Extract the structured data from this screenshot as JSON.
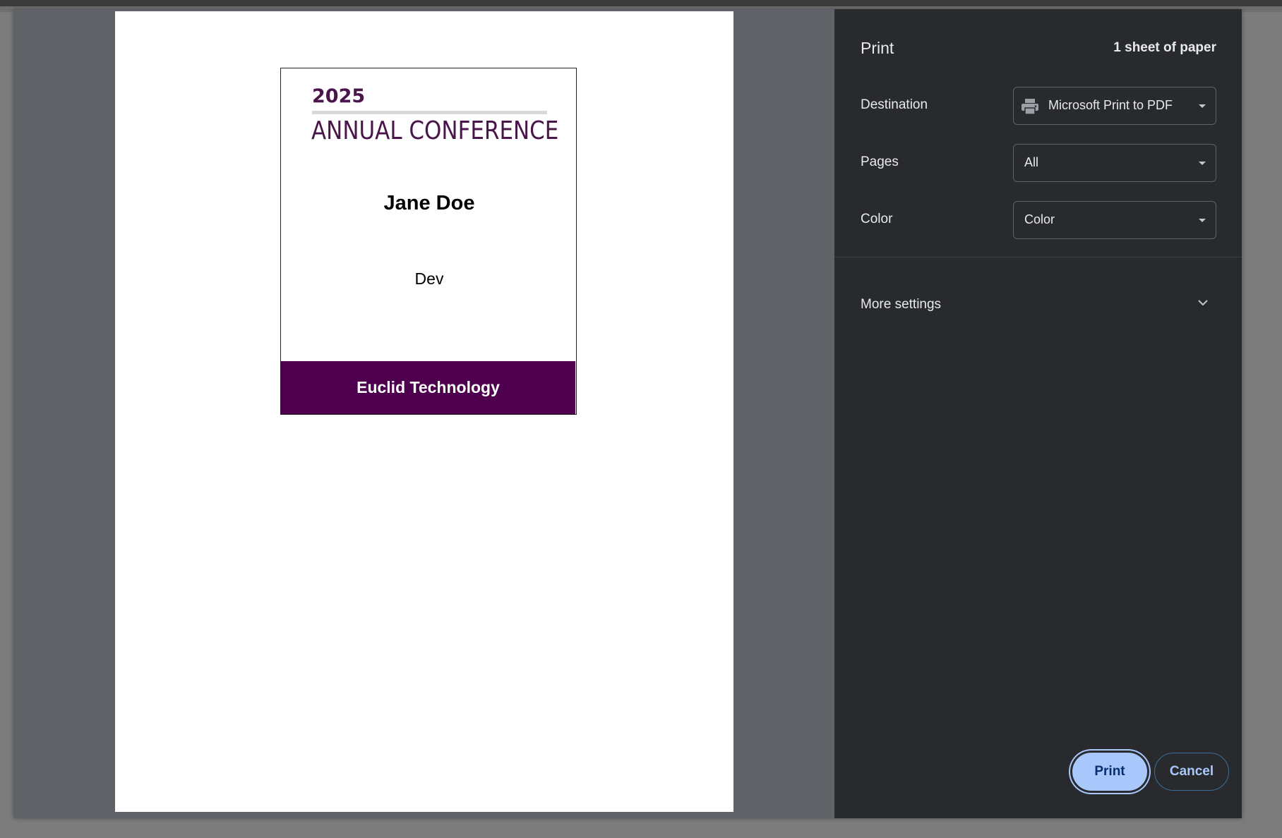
{
  "badge": {
    "year": "2025",
    "conference": "ANNUAL CONFERENCE",
    "name": "Jane Doe",
    "role": "Dev",
    "company": "Euclid Technology",
    "accent_color": "#4e004e"
  },
  "print": {
    "title": "Print",
    "sheets": "1 sheet of paper",
    "destination": {
      "label": "Destination",
      "value": "Microsoft Print to PDF",
      "icon": "printer-icon"
    },
    "pages": {
      "label": "Pages",
      "value": "All"
    },
    "color": {
      "label": "Color",
      "value": "Color"
    },
    "more_settings": "More settings",
    "print_button": "Print",
    "cancel_button": "Cancel",
    "accent_color": "#a8c7fa"
  }
}
